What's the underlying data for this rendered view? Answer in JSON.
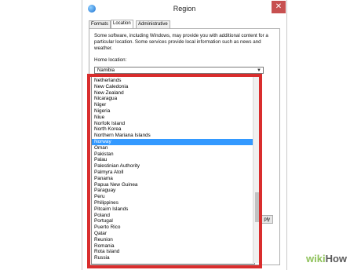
{
  "window": {
    "title": "Region",
    "close_glyph": "✕"
  },
  "tabs": [
    {
      "label": "Formats",
      "active": false
    },
    {
      "label": "Location",
      "active": true
    },
    {
      "label": "Administrative",
      "active": false
    }
  ],
  "panel": {
    "description": "Some software, including Windows, may provide you with additional content for a particular location. Some services provide local information such as news and weather.",
    "home_location_label": "Home location:",
    "home_location_value": "Namibia",
    "dropdown_arrow": "▼"
  },
  "dropdown_items": [
    "Netherlands",
    "New Caledonia",
    "New Zealand",
    "Nicaragua",
    "Niger",
    "Nigeria",
    "Niue",
    "Norfolk Island",
    "North Korea",
    "Northern Mariana Islands",
    "Norway",
    "Oman",
    "Pakistan",
    "Palau",
    "Palestinian Authority",
    "Palmyra Atoll",
    "Panama",
    "Papua New Guinea",
    "Paraguay",
    "Peru",
    "Philippines",
    "Pitcairn Islands",
    "Poland",
    "Portugal",
    "Puerto Rico",
    "Qatar",
    "Reunion",
    "Romania",
    "Rota Island",
    "Russia"
  ],
  "selected_item": "Norway",
  "apply_button_label": "ply",
  "brand": {
    "wiki": "wiki",
    "how": "How"
  },
  "colors": {
    "highlight": "#d92d2d",
    "selection": "#3399ff"
  }
}
